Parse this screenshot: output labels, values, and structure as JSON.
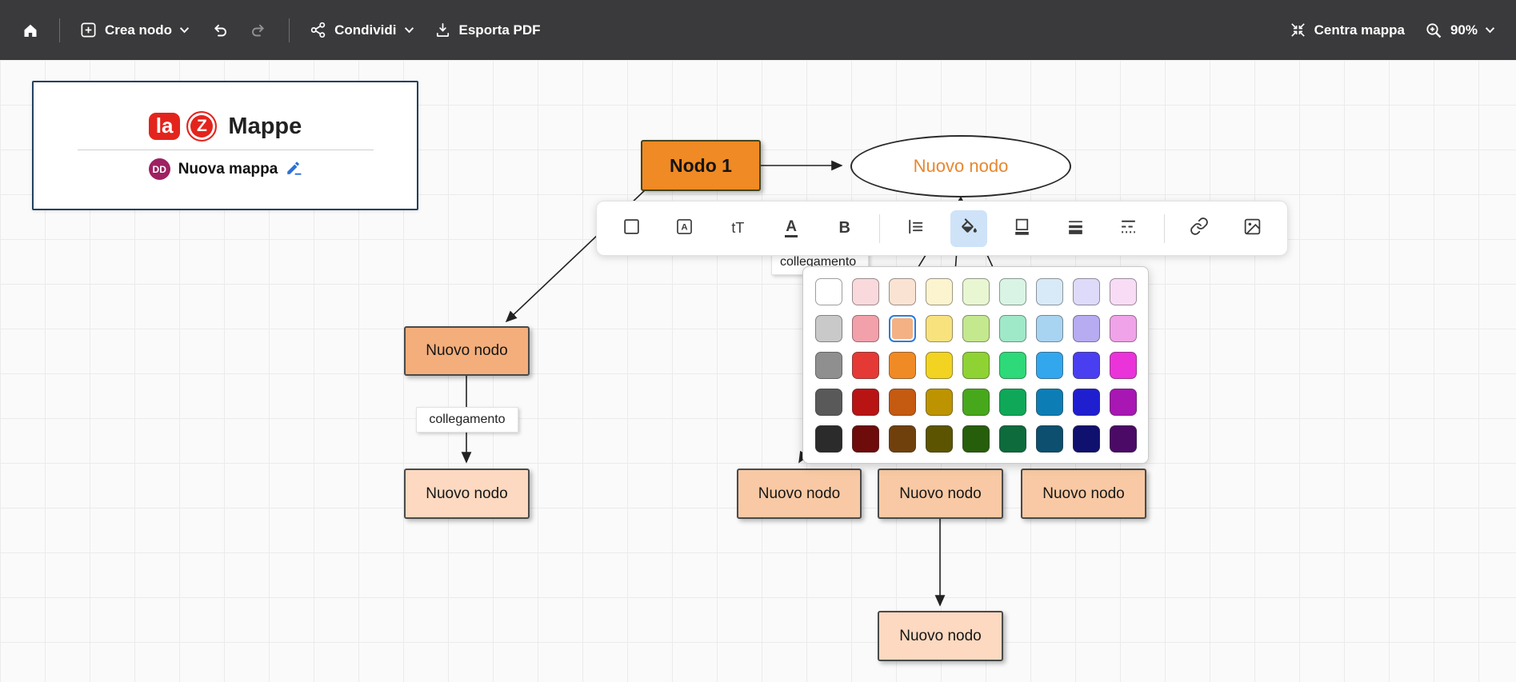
{
  "topbar": {
    "crea_nodo": "Crea nodo",
    "condividi": "Condividi",
    "esporta_pdf": "Esporta PDF",
    "centra_mappa": "Centra mappa",
    "zoom_level": "90%"
  },
  "map_card": {
    "logo_la": "la",
    "logo_z": "Z",
    "logo_name": "Mappe",
    "avatar_initials": "DD",
    "map_title": "Nuova mappa"
  },
  "canvas": {
    "nodes": {
      "nodo1": "Nodo 1",
      "ellipse": "Nuovo nodo",
      "left_child": "Nuovo nodo",
      "left_grandchild": "Nuovo nodo",
      "bottom_left": "Nuovo nodo",
      "bottom_middle": "Nuovo nodo",
      "bottom_right": "Nuovo nodo",
      "bottom_child": "Nuovo nodo"
    },
    "edge_labels": {
      "left_label": "collegamento",
      "hidden_label": "collegamento"
    }
  },
  "format_toolbar": {
    "font_size_label": "tT",
    "font_color_label": "A",
    "bold_label": "B",
    "active_tool": "fill-color",
    "active_bg": "#cfe3f8"
  },
  "palette": {
    "selected": {
      "row": 1,
      "col": 2
    },
    "selection_ring": "#2a7de1",
    "rows": [
      [
        "#ffffff",
        "#f9d9dc",
        "#fbe3d4",
        "#fcf4cf",
        "#e9f6d2",
        "#d9f4e4",
        "#d8eaf8",
        "#dedaf9",
        "#f8dcf6"
      ],
      [
        "#c9c9c9",
        "#f2a0aa",
        "#f4b183",
        "#f7e27d",
        "#c4e88e",
        "#9fe8c8",
        "#a8d4f2",
        "#b7abf2",
        "#f0a3e8"
      ],
      [
        "#8f8f8f",
        "#e53935",
        "#f08a24",
        "#f2d321",
        "#8ed333",
        "#2dd978",
        "#33a7ee",
        "#4a3ff0",
        "#ea33d9"
      ],
      [
        "#595959",
        "#b81414",
        "#c55a11",
        "#bd9400",
        "#47a81c",
        "#0fa858",
        "#0d7eb5",
        "#1f1fd0",
        "#a816b4"
      ],
      [
        "#2b2b2b",
        "#6e0b0b",
        "#70400c",
        "#5c5400",
        "#275e0b",
        "#0d6b3c",
        "#0c4f6e",
        "#10106e",
        "#4b0a66"
      ]
    ]
  }
}
